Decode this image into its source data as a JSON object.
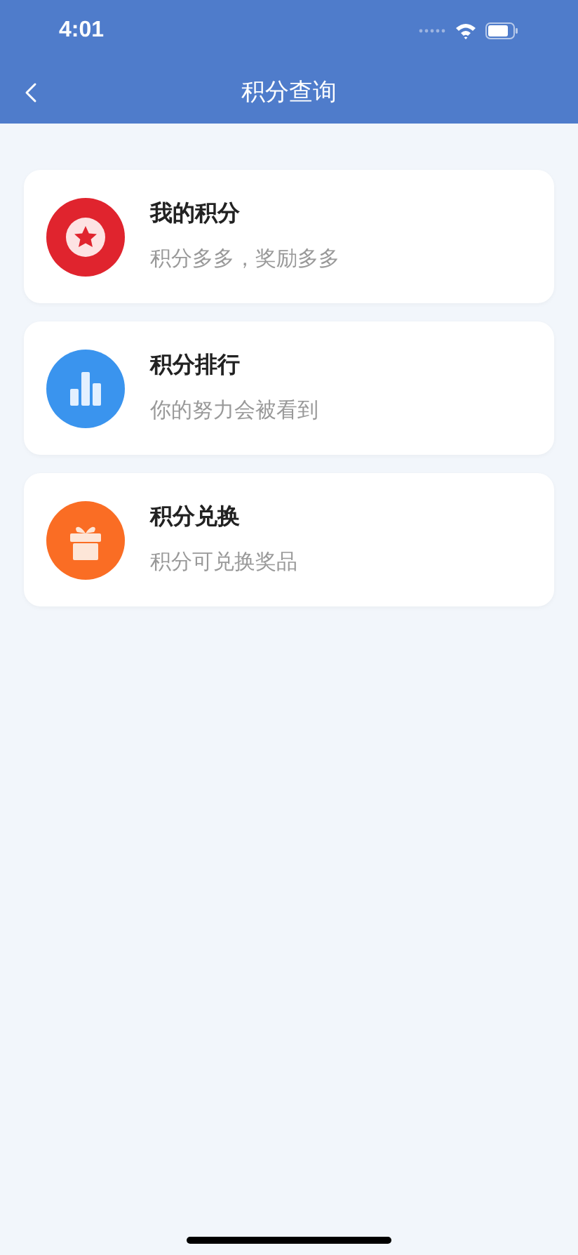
{
  "status_bar": {
    "time": "4:01"
  },
  "nav_bar": {
    "title": "积分查询"
  },
  "items": [
    {
      "title": "我的积分",
      "subtitle": "积分多多，奖励多多",
      "kind": "star",
      "color": "#e0242e"
    },
    {
      "title": "积分排行",
      "subtitle": "你的努力会被看到",
      "kind": "chart",
      "color": "#3a94ee"
    },
    {
      "title": "积分兑换",
      "subtitle": "积分可兑换奖品",
      "kind": "gift",
      "color": "#fa6d24"
    }
  ]
}
